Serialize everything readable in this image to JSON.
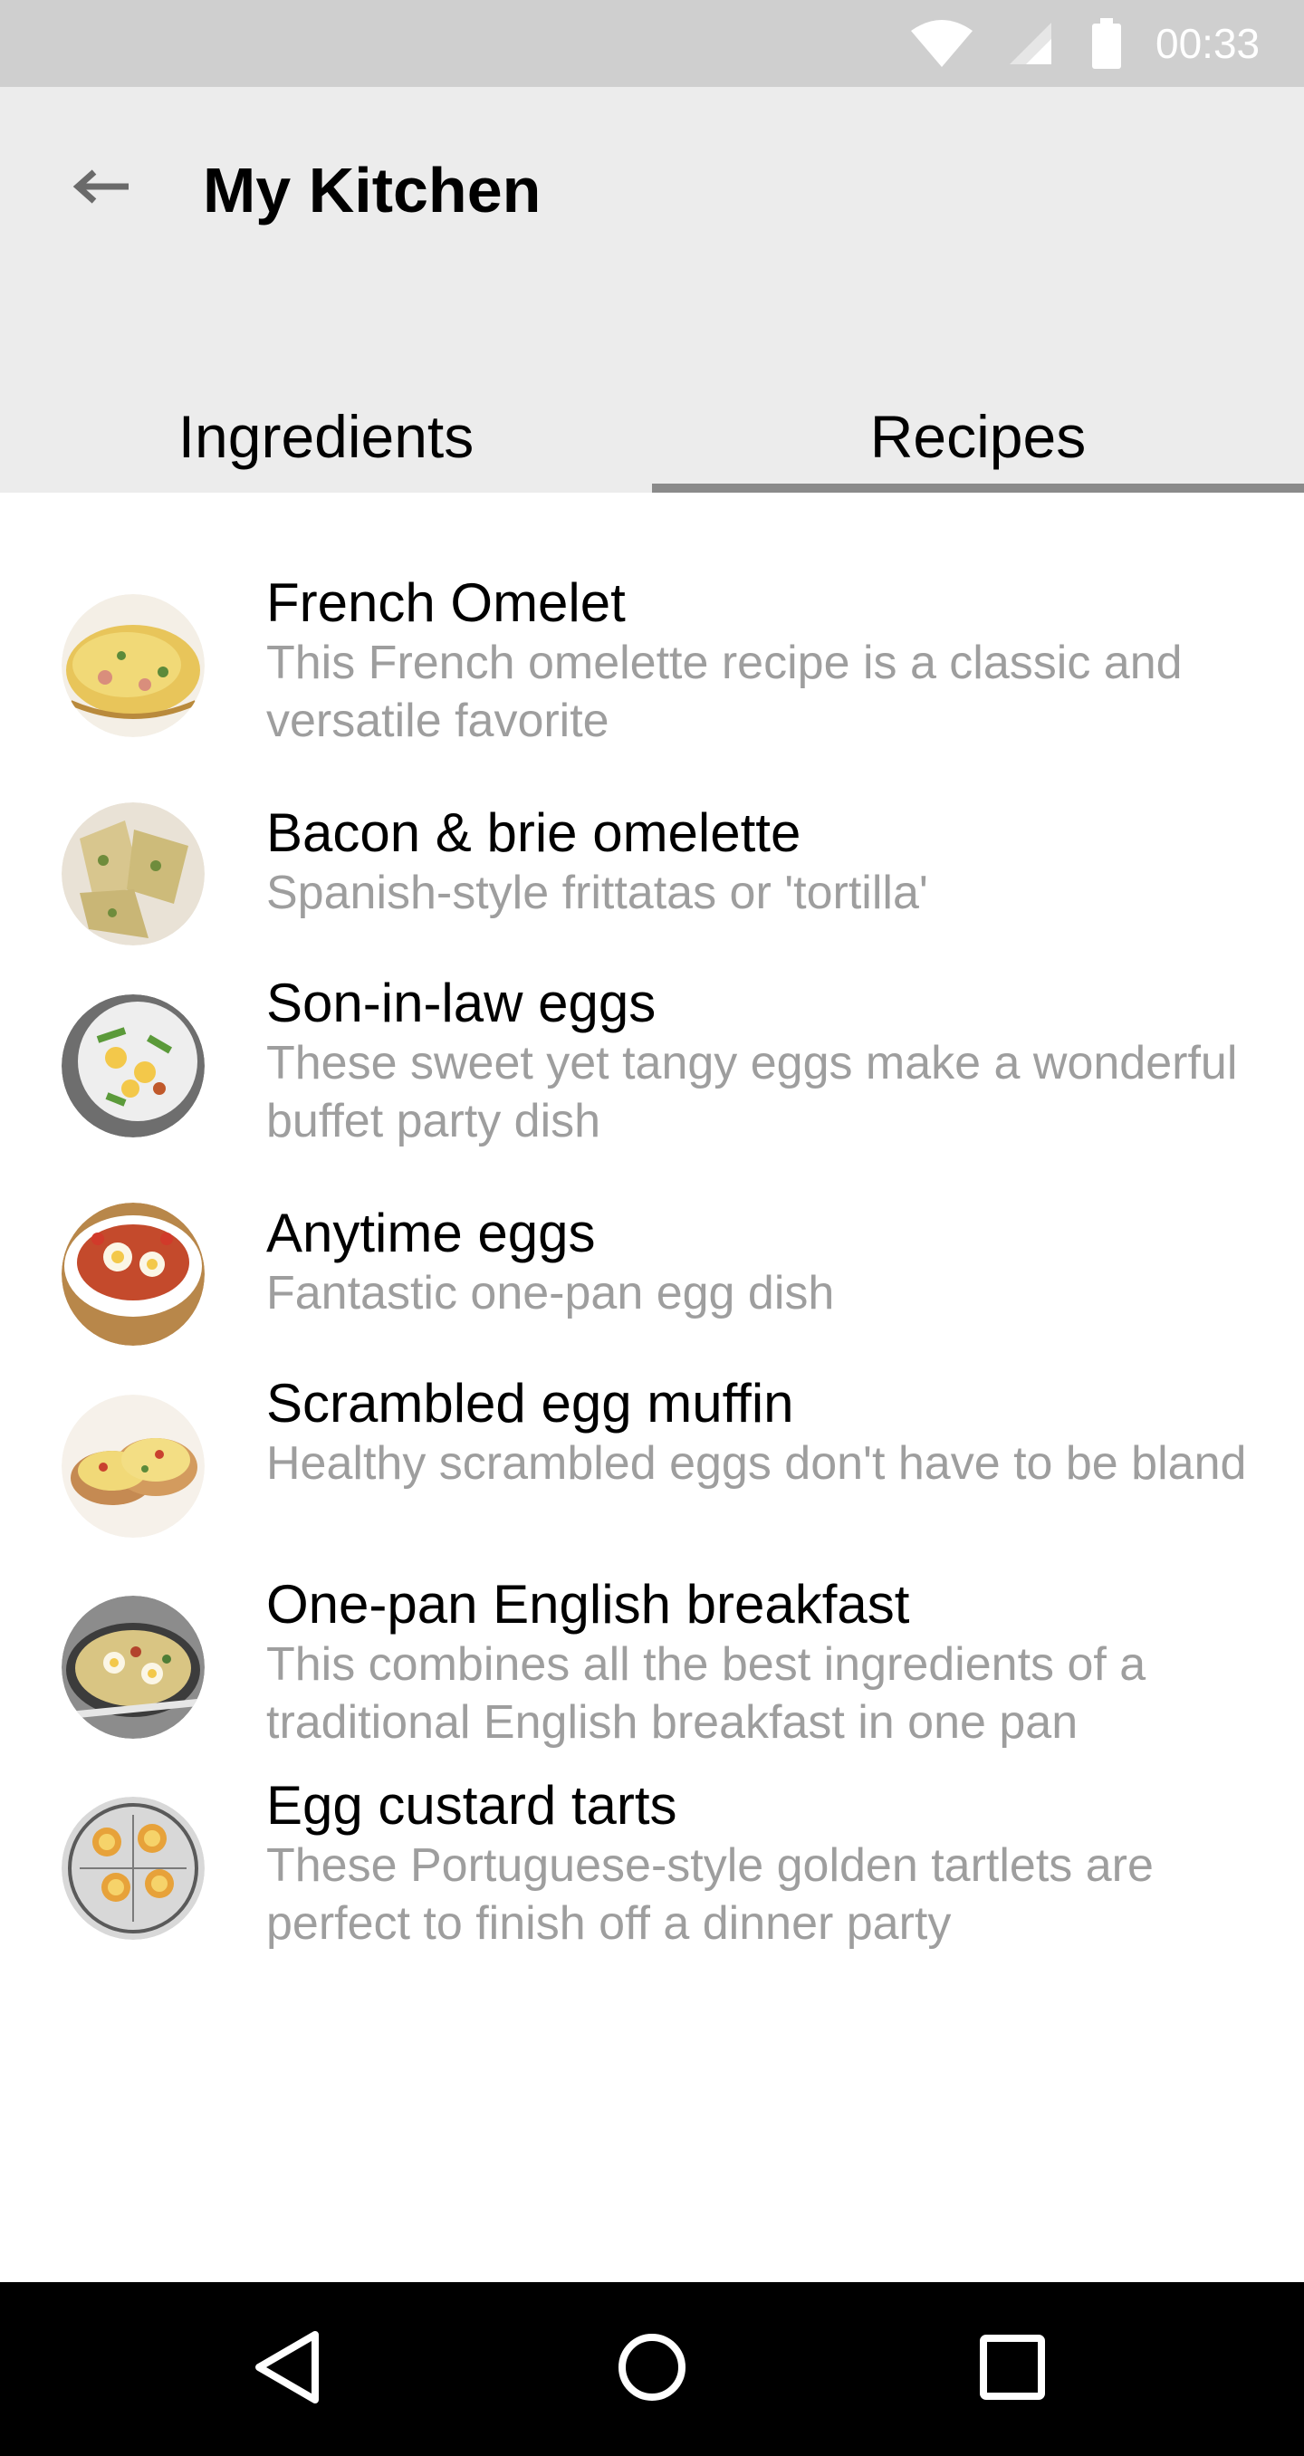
{
  "status_bar": {
    "time": "00:33",
    "icons": [
      "wifi-icon",
      "signal-icon",
      "battery-icon"
    ]
  },
  "header": {
    "back_icon": "arrow-left-icon",
    "title": "My Kitchen"
  },
  "tabs": [
    {
      "label": "Ingredients",
      "selected": false
    },
    {
      "label": "Recipes",
      "selected": true
    }
  ],
  "recipes": [
    {
      "title": "French Omelet",
      "description": "This French omelette recipe is a classic and versatile favorite"
    },
    {
      "title": "Bacon & brie omelette",
      "description": "Spanish-style frittatas or 'tortilla'"
    },
    {
      "title": "Son-in-law eggs",
      "description": "These sweet yet tangy eggs make a wonderful buffet party dish"
    },
    {
      "title": "Anytime eggs",
      "description": "Fantastic one-pan egg dish"
    },
    {
      "title": "Scrambled egg muffin",
      "description": "Healthy scrambled eggs don't have to be bland"
    },
    {
      "title": "One-pan English breakfast",
      "description": "This combines all the best ingredients of a traditional English breakfast in one pan"
    },
    {
      "title": "Egg custard tarts",
      "description": "These Portuguese-style golden tartlets are perfect to finish off a dinner party"
    }
  ],
  "nav_bar": {
    "icons": [
      "back-triangle-icon",
      "home-circle-icon",
      "recents-square-icon"
    ]
  }
}
